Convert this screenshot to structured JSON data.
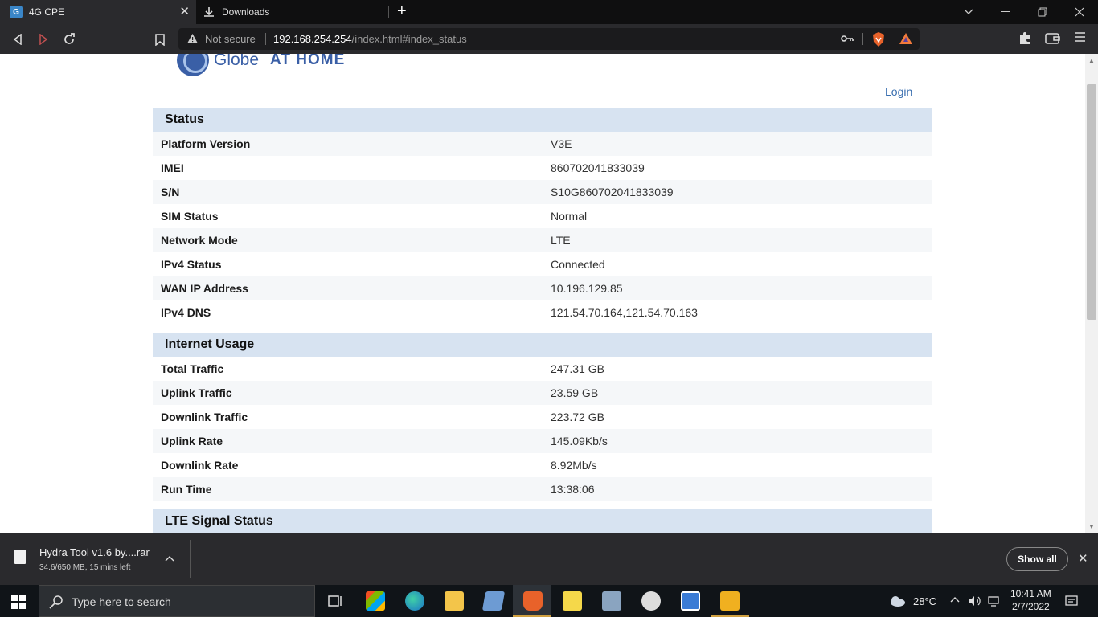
{
  "browser": {
    "tabs": [
      {
        "title": "4G CPE",
        "active": true
      },
      {
        "title": "Downloads",
        "active": false
      }
    ],
    "address": {
      "security_label": "Not secure",
      "url_host": "192.168.254.254",
      "url_path": "/index.html#index_status"
    }
  },
  "page": {
    "logo": {
      "brand": "Globe",
      "tagline": "AT HOME"
    },
    "login_label": "Login",
    "sections": [
      {
        "title": "Status",
        "rows": [
          {
            "label": "Platform Version",
            "value": "V3E"
          },
          {
            "label": "IMEI",
            "value": "860702041833039"
          },
          {
            "label": "S/N",
            "value": "S10G860702041833039"
          },
          {
            "label": "SIM Status",
            "value": "Normal"
          },
          {
            "label": "Network Mode",
            "value": "LTE"
          },
          {
            "label": "IPv4 Status",
            "value": "Connected"
          },
          {
            "label": "WAN IP Address",
            "value": "10.196.129.85"
          },
          {
            "label": "IPv4 DNS",
            "value": "121.54.70.164,121.54.70.163"
          }
        ]
      },
      {
        "title": "Internet Usage",
        "rows": [
          {
            "label": "Total Traffic",
            "value": "247.31 GB"
          },
          {
            "label": "Uplink Traffic",
            "value": "23.59 GB"
          },
          {
            "label": "Downlink Traffic",
            "value": "223.72 GB"
          },
          {
            "label": "Uplink Rate",
            "value": "145.09Kb/s"
          },
          {
            "label": "Downlink Rate",
            "value": "8.92Mb/s"
          },
          {
            "label": "Run Time",
            "value": "13:38:06"
          }
        ]
      },
      {
        "title": "LTE Signal Status",
        "rows": []
      }
    ]
  },
  "download_shelf": {
    "file_name": "Hydra Tool v1.6 by....rar",
    "file_status": "34.6/650 MB, 15 mins left",
    "show_all_label": "Show all"
  },
  "taskbar": {
    "search_placeholder": "Type here to search",
    "temperature": "28°C",
    "time": "10:41 AM",
    "date": "2/7/2022"
  },
  "colors": {
    "section_header_bg": "#d7e3f1",
    "link": "#3a6fb0",
    "brand": "#3a5fa6"
  }
}
